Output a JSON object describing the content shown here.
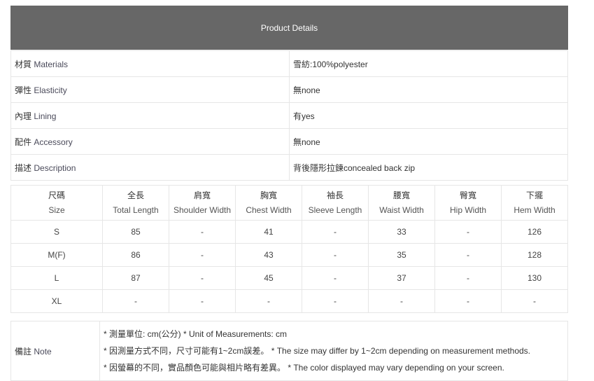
{
  "details": {
    "title": "Product Details",
    "rows": [
      {
        "label_zh": "材質",
        "label_en": "Materials",
        "value": "雪紡:100%polyester"
      },
      {
        "label_zh": "彈性",
        "label_en": "Elasticity",
        "value": "無none"
      },
      {
        "label_zh": "內理",
        "label_en": "Lining",
        "value": "有yes"
      },
      {
        "label_zh": "配件",
        "label_en": "Accessory",
        "value": "無none"
      },
      {
        "label_zh": "描述",
        "label_en": "Description",
        "value": "背後隱形拉鍊concealed back zip"
      }
    ]
  },
  "size_chart": {
    "headers": [
      {
        "zh": "尺碼",
        "en": "Size"
      },
      {
        "zh": "全長",
        "en": "Total Length"
      },
      {
        "zh": "肩寬",
        "en": "Shoulder Width"
      },
      {
        "zh": "胸寬",
        "en": "Chest Width"
      },
      {
        "zh": "袖長",
        "en": "Sleeve Length"
      },
      {
        "zh": "腰寬",
        "en": "Waist Width"
      },
      {
        "zh": "臀寬",
        "en": "Hip Width"
      },
      {
        "zh": "下擺",
        "en": "Hem Width"
      }
    ],
    "rows": [
      [
        "S",
        "85",
        "-",
        "41",
        "-",
        "33",
        "-",
        "126"
      ],
      [
        "M(F)",
        "86",
        "-",
        "43",
        "-",
        "35",
        "-",
        "128"
      ],
      [
        "L",
        "87",
        "-",
        "45",
        "-",
        "37",
        "-",
        "130"
      ],
      [
        "XL",
        "-",
        "-",
        "-",
        "-",
        "-",
        "-",
        "-"
      ]
    ]
  },
  "note": {
    "label_zh": "備註",
    "label_en": "Note",
    "lines": [
      "* 測量單位: cm(公分) * Unit of Measurements: cm",
      "* 因測量方式不同，尺寸可能有1~2cm誤差。 * The size may differ by 1~2cm depending on measurement methods.",
      "* 因螢幕的不同，實品顏色可能與相片略有差異。 * The color displayed may vary depending on your screen."
    ]
  }
}
